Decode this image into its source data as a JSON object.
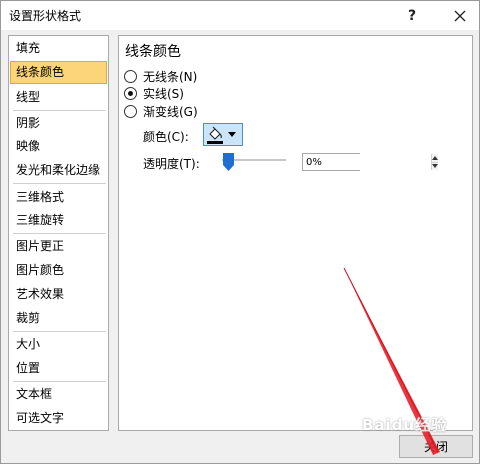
{
  "window": {
    "title": "设置形状格式",
    "help_label": "?"
  },
  "categories": [
    {
      "label": "填充"
    },
    {
      "label": "线条颜色"
    },
    {
      "label": "线型"
    },
    {
      "label": "阴影"
    },
    {
      "label": "映像"
    },
    {
      "label": "发光和柔化边缘"
    },
    {
      "label": "三维格式"
    },
    {
      "label": "三维旋转"
    },
    {
      "label": "图片更正"
    },
    {
      "label": "图片颜色"
    },
    {
      "label": "艺术效果"
    },
    {
      "label": "裁剪"
    },
    {
      "label": "大小"
    },
    {
      "label": "位置"
    },
    {
      "label": "文本框"
    },
    {
      "label": "可选文字"
    }
  ],
  "selected_category": "线条颜色",
  "panel": {
    "title": "线条颜色",
    "options": [
      {
        "label": "无线条(N)",
        "checked": false
      },
      {
        "label": "实线(S)",
        "checked": true
      },
      {
        "label": "渐变线(G)",
        "checked": false
      }
    ],
    "color_label": "颜色(C):",
    "transparency_label": "透明度(T):",
    "transparency_value": "0%",
    "transparency_fraction": 0
  },
  "footer": {
    "close_label": "关闭"
  },
  "watermark": "Baidu经验",
  "colors": {
    "selected_bg": "#fcd47a",
    "accent_blue": "#1e6fd0",
    "annotation_red": "#e8202a"
  }
}
